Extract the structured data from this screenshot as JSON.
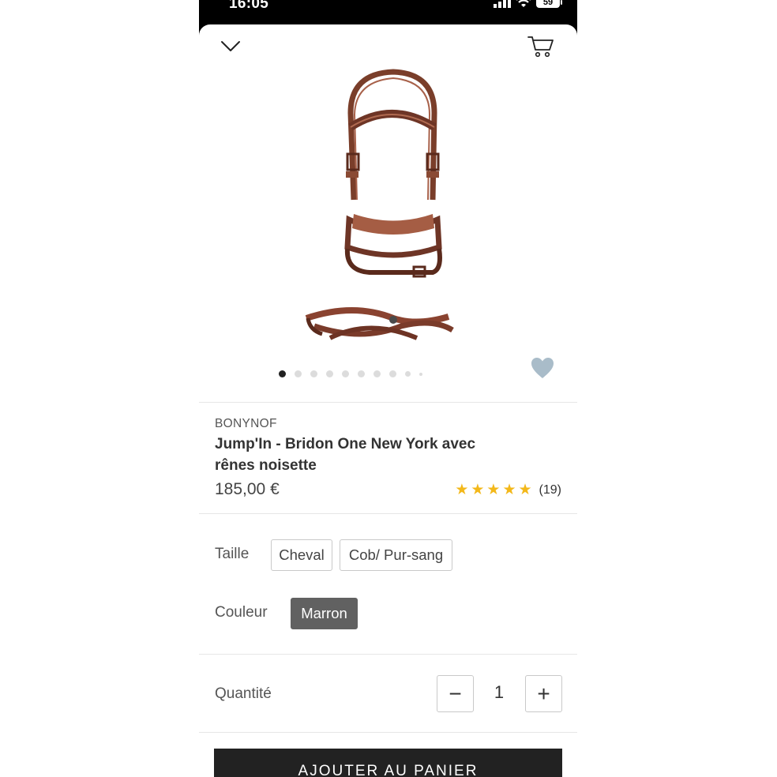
{
  "status_bar": {
    "time": "16:05",
    "battery": "59"
  },
  "product": {
    "brand": "BONYNOF",
    "title": "Jump'In - Bridon One New York avec rênes noisette",
    "price": "185,00 €",
    "rating": {
      "stars": 5,
      "count_label": "(19)"
    },
    "image_count": 10,
    "active_image": 1
  },
  "options": {
    "size": {
      "label": "Taille",
      "choices": [
        "Cheval",
        "Cob/ Pur-sang"
      ]
    },
    "color": {
      "label": "Couleur",
      "choices": [
        "Marron"
      ],
      "selected": "Marron"
    }
  },
  "quantity": {
    "label": "Quantité",
    "value": "1",
    "minus": "−",
    "plus": "+"
  },
  "cta": {
    "add_to_cart": "AJOUTER AU PANIER"
  },
  "icons": {
    "close": "chevron-down-icon",
    "cart": "cart-icon",
    "favorite": "heart-icon",
    "star": "star-icon"
  },
  "colors": {
    "star": "#f3b81a",
    "selected_chip": "#616161",
    "cta": "#222222",
    "heart": "#a9bcc9"
  }
}
